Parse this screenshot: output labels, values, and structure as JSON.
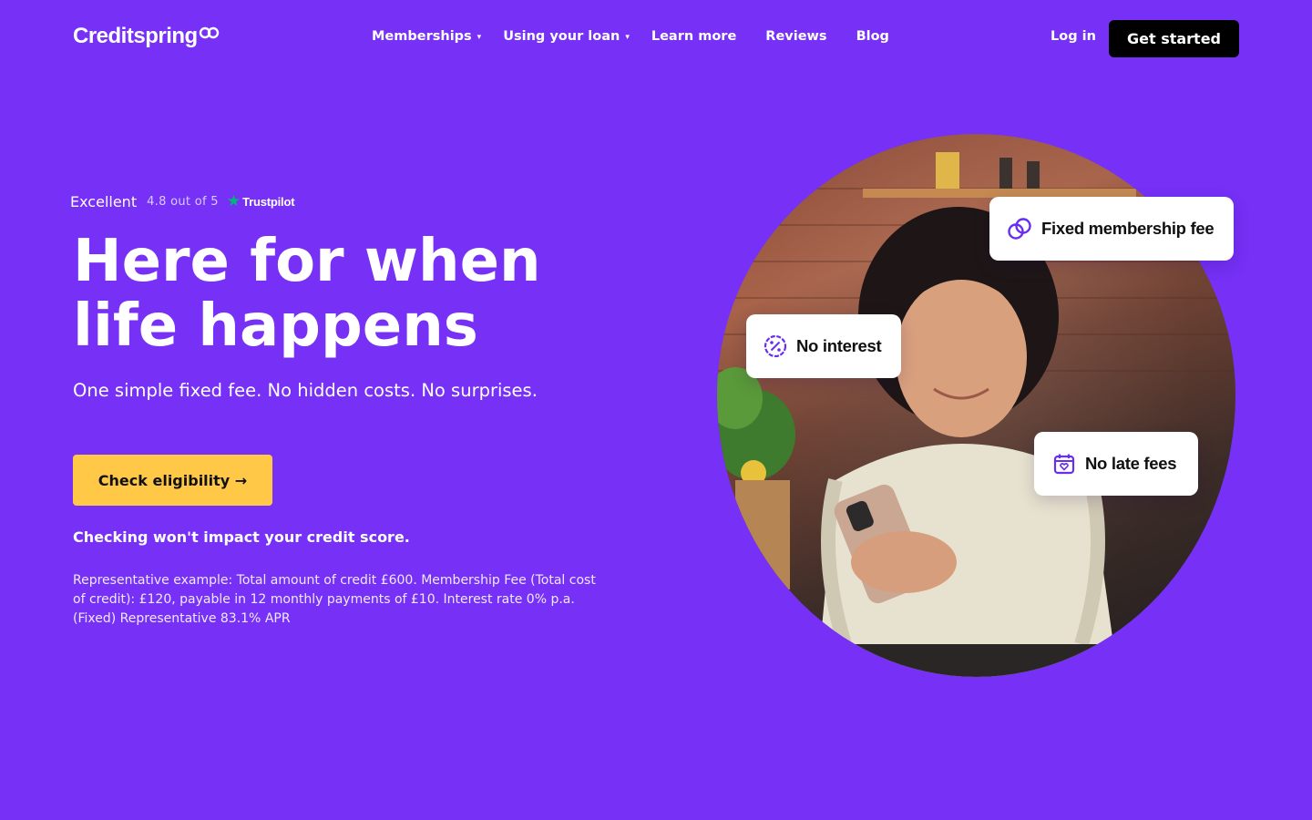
{
  "brand": {
    "logo_text": "Creditspring",
    "accent_color": "#7630f6",
    "cta_color": "#ffc846"
  },
  "nav": {
    "links": [
      {
        "label": "Memberships",
        "dropdown": true
      },
      {
        "label": "Using your loan",
        "dropdown": true
      },
      {
        "label": "Learn more",
        "dropdown": false
      },
      {
        "label": "Reviews",
        "dropdown": false
      },
      {
        "label": "Blog",
        "dropdown": false
      }
    ],
    "caret_glyph": "▾",
    "login_label": "Log in",
    "get_started_label": "Get started"
  },
  "trustpilot": {
    "rating_word": "Excellent",
    "score_text": "4.8 out of 5",
    "star_glyph": "★",
    "brand": "Trustpilot"
  },
  "hero": {
    "headline": "Here for when life happens",
    "subhead": "One simple fixed fee. No hidden costs. No surprises.",
    "cta_label": "Check eligibility →",
    "disclaimer": "Checking won't impact your credit score.",
    "representative_example": "Representative example: Total amount of credit £600. Membership Fee (Total cost of credit): £120, payable in 12 monthly payments of £10. Interest rate 0% p.a. (Fixed) Representative 83.1% APR"
  },
  "features": {
    "fixed_fee": {
      "label": "Fixed membership fee",
      "icon": "linked-rings-icon"
    },
    "no_interest": {
      "label": "No interest",
      "icon": "percent-badge-icon"
    },
    "no_late_fees": {
      "label": "No late fees",
      "icon": "calendar-heart-icon"
    }
  }
}
